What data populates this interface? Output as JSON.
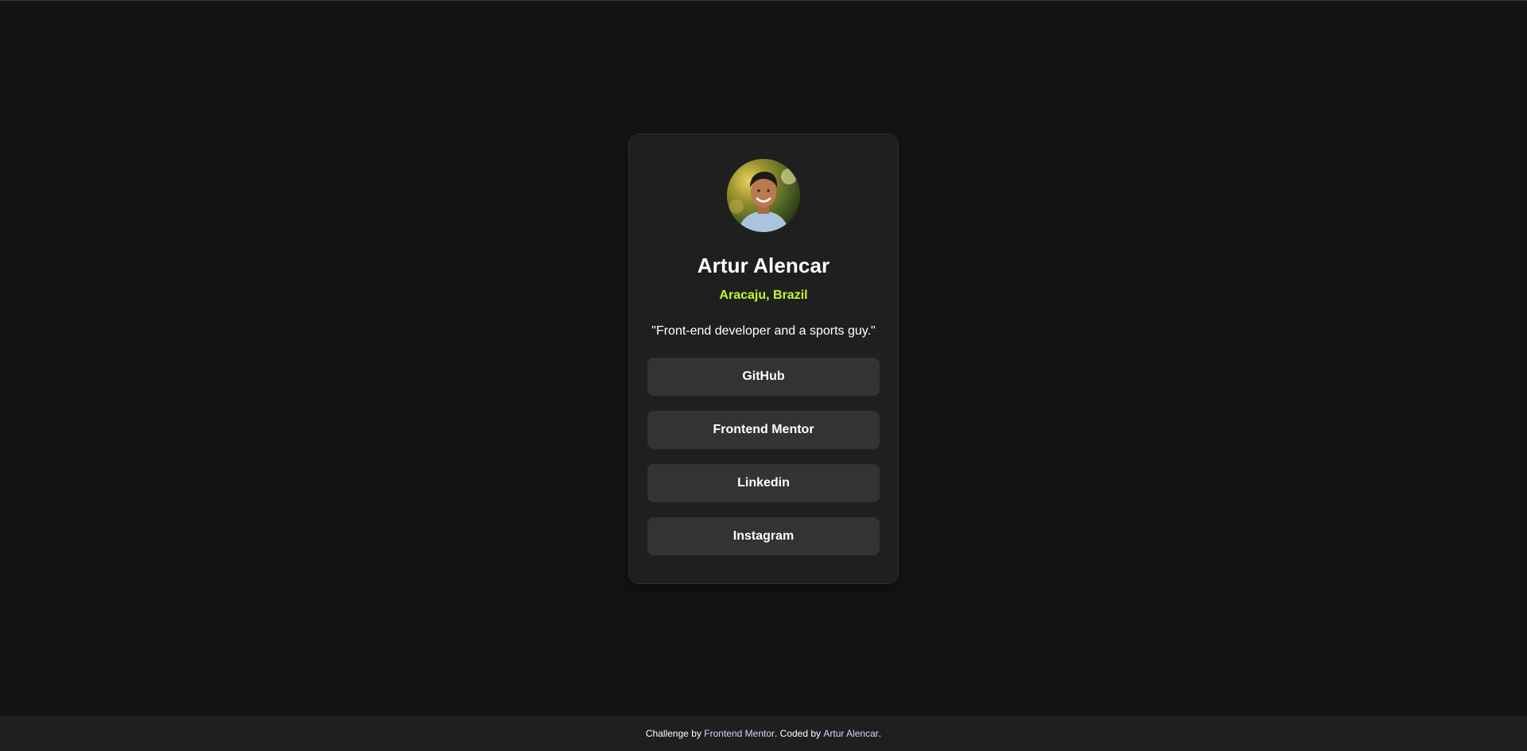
{
  "profile": {
    "name": "Artur Alencar",
    "location": "Aracaju, Brazil",
    "bio": "\"Front-end developer and a sports guy.\"",
    "avatar_icon": "avatar-photo"
  },
  "links": [
    {
      "label": "GitHub"
    },
    {
      "label": "Frontend Mentor"
    },
    {
      "label": "Linkedin"
    },
    {
      "label": "Instagram"
    }
  ],
  "footer": {
    "prefix": "Challenge by ",
    "challenge_link": "Frontend Mentor",
    "middle": ". Coded by ",
    "author_link": "Artur Alencar",
    "suffix": "."
  },
  "colors": {
    "background": "#141414",
    "card": "#1f1f1f",
    "button": "#333333",
    "accent": "#c4f82a",
    "text": "#ffffff"
  }
}
